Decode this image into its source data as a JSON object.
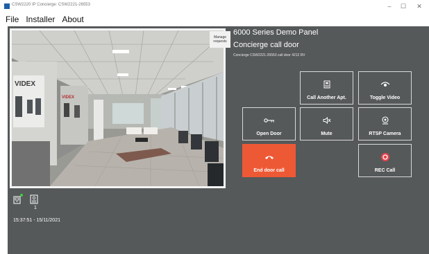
{
  "window": {
    "title": "CSW2220 IP Concierge: CSW2221-26553",
    "controls": {
      "minimize": "–",
      "maximize": "☐",
      "close": "✕"
    }
  },
  "menu": {
    "items": [
      "File",
      "Installer",
      "About"
    ]
  },
  "video": {
    "manage_requests_label": "Manage requests"
  },
  "panel": {
    "title": "6000 Series Demo Panel",
    "door_name": "Concierge call door",
    "door_info": "Concierge CSW2221-26553 call door 4212 RV"
  },
  "buttons": {
    "call_another": {
      "label": "Call Another Apt.",
      "icon": "building-icon"
    },
    "toggle_video": {
      "label": "Toggle Video",
      "icon": "eye-icon"
    },
    "open_door": {
      "label": "Open Door",
      "icon": "key-icon"
    },
    "mute": {
      "label": "Mute",
      "icon": "speaker-mute-icon"
    },
    "rtsp_camera": {
      "label": "RTSP Camera",
      "icon": "camera-icon"
    },
    "end_call": {
      "label": "End door call",
      "icon": "hang-up-icon"
    },
    "rec_call": {
      "label": "REC Call",
      "icon": "record-icon"
    }
  },
  "status": {
    "queue_count": "1",
    "datetime": "15:37:51 - 15/11/2021"
  },
  "colors": {
    "panel_bg": "#56595a",
    "end_call": "#ee5935",
    "record": "#e8424c",
    "status_dot": "#3bd13b"
  }
}
